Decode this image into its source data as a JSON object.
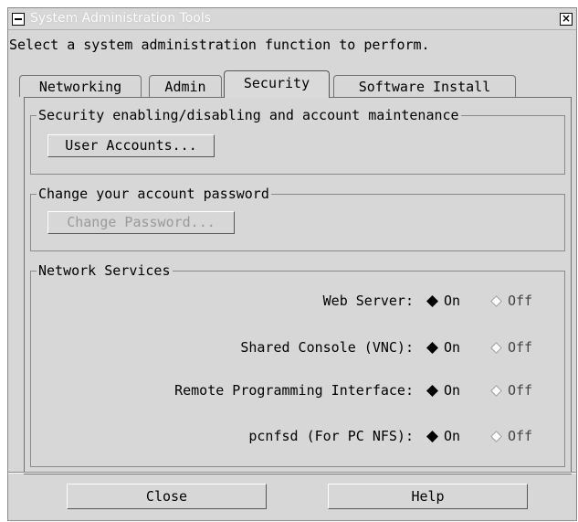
{
  "window": {
    "title": "System Administration Tools"
  },
  "prompt": "Select a system administration function to perform.",
  "tabs": [
    {
      "label": "Networking",
      "active": false
    },
    {
      "label": "Admin",
      "active": false
    },
    {
      "label": "Security",
      "active": true
    },
    {
      "label": "Software Install",
      "active": false
    }
  ],
  "groups": {
    "security": {
      "legend": "Security enabling/disabling and account maintenance",
      "button": "User Accounts..."
    },
    "password": {
      "legend": "Change your account password",
      "button": "Change Password..."
    },
    "network": {
      "legend": "Network Services",
      "services": [
        {
          "label": "Web Server:",
          "on": "On",
          "off": "Off",
          "selected": "On"
        },
        {
          "label": "Shared Console (VNC):",
          "on": "On",
          "off": "Off",
          "selected": "On"
        },
        {
          "label": "Remote Programming Interface:",
          "on": "On",
          "off": "Off",
          "selected": "On"
        },
        {
          "label": "pcnfsd (For PC NFS):",
          "on": "On",
          "off": "Off",
          "selected": "On"
        }
      ]
    }
  },
  "footer": {
    "close": "Close",
    "help": "Help"
  },
  "icons": {
    "system_menu": "system-menu-icon",
    "close": "window-close-icon",
    "radio_selected": "diamond-filled",
    "radio_unselected": "diamond-empty"
  }
}
